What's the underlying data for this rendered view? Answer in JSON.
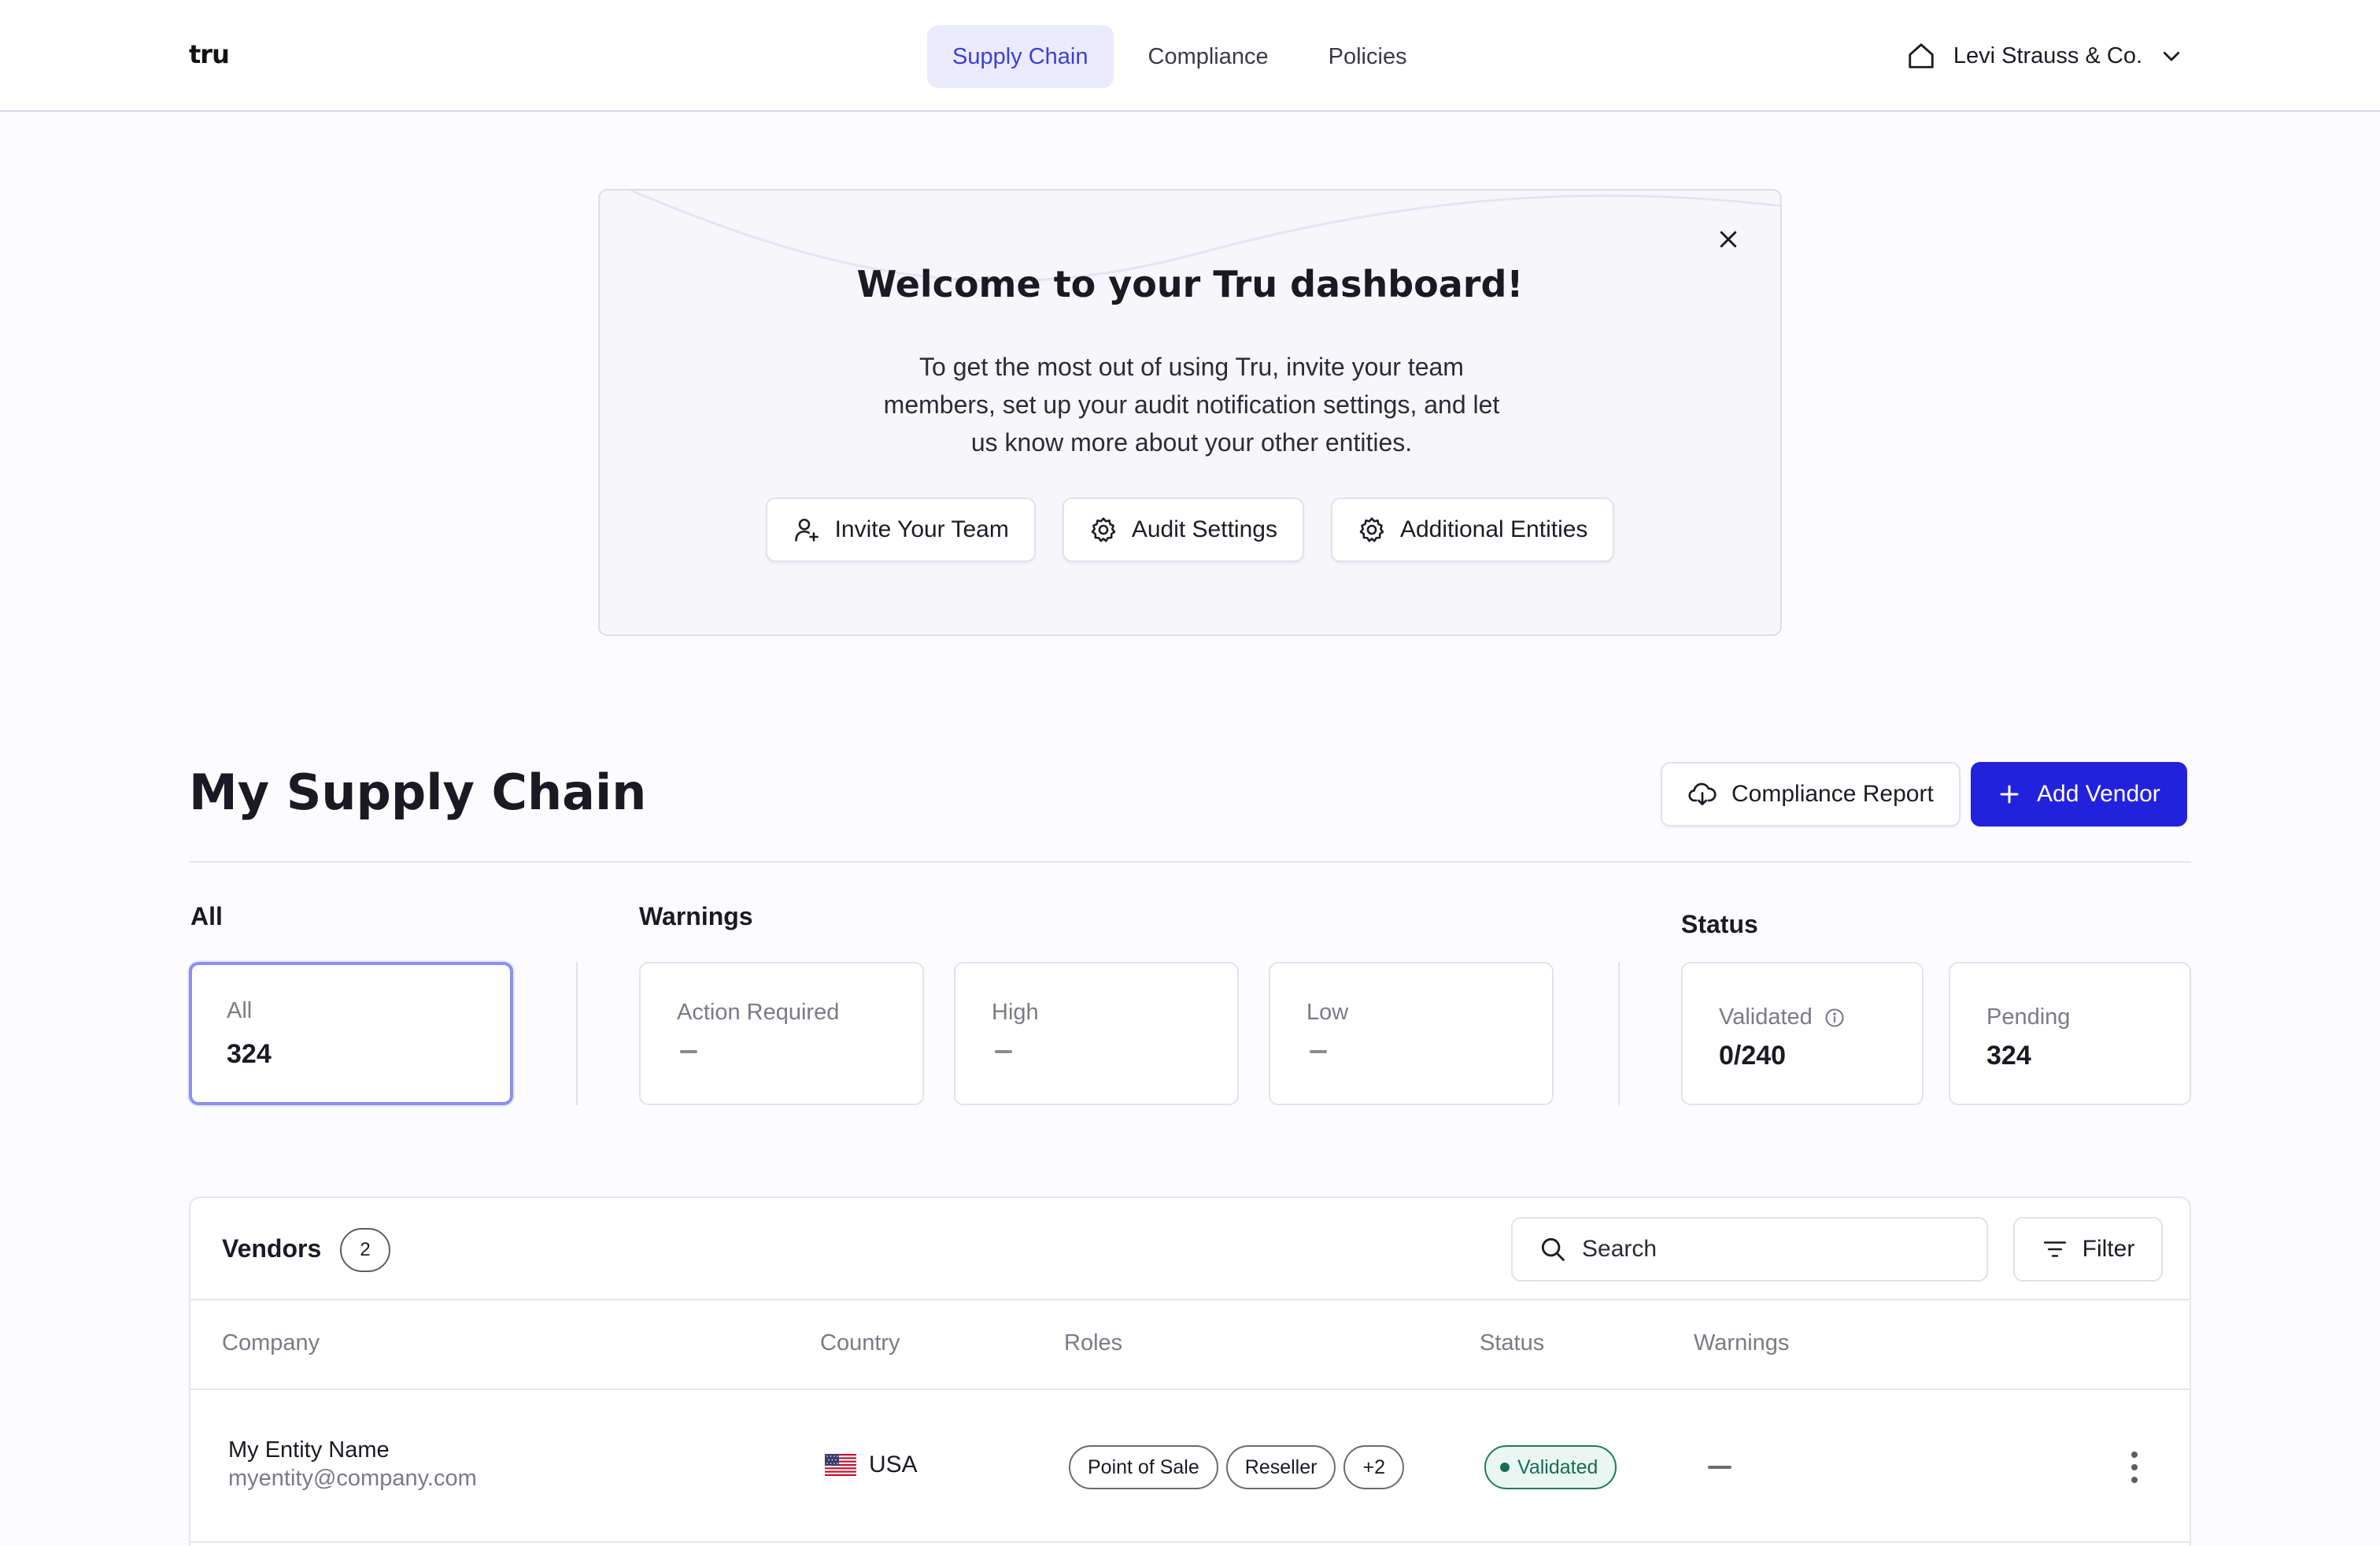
{
  "app": {
    "logo": "tru"
  },
  "nav": {
    "tabs": [
      {
        "label": "Supply Chain",
        "active": true
      },
      {
        "label": "Compliance",
        "active": false
      },
      {
        "label": "Policies",
        "active": false
      }
    ],
    "org_name": "Levi Strauss & Co.",
    "org_icon": "home-icon",
    "accent_color": "#3b3fd8"
  },
  "welcome": {
    "title": "Welcome to your Tru dashboard!",
    "body_lines": [
      "To get the most out of using Tru, invite your team",
      "members, set up your audit notification settings, and let",
      "us know more about your other entities."
    ],
    "actions": [
      {
        "label": "Invite Your Team",
        "icon": "user-plus-icon"
      },
      {
        "label": "Audit Settings",
        "icon": "gear-icon"
      },
      {
        "label": "Additional Entities",
        "icon": "gear-icon"
      }
    ]
  },
  "section": {
    "title": "My Supply Chain",
    "report_button": "Compliance Report",
    "add_button": "Add Vendor",
    "primary_color": "#2222dd"
  },
  "stats": {
    "all": {
      "group_label": "All",
      "card_label": "All",
      "value": "324"
    },
    "warnings": {
      "group_label": "Warnings",
      "cards": [
        {
          "label": "Action Required"
        },
        {
          "label": "High"
        },
        {
          "label": "Low"
        }
      ]
    },
    "status": {
      "group_label": "Status",
      "validated": {
        "label": "Validated",
        "value": "0/240"
      },
      "pending": {
        "label": "Pending",
        "value": "324"
      }
    }
  },
  "vendors": {
    "title": "Vendors",
    "count": "2",
    "search_placeholder": "Search",
    "filter_label": "Filter",
    "columns": [
      "Company",
      "Country",
      "Roles",
      "Status",
      "Warnings"
    ],
    "rows": [
      {
        "name": "My Entity Name",
        "email": "myentity@company.com",
        "country": "USA",
        "roles": [
          "Point of Sale",
          "Reseller",
          "+2"
        ],
        "status": "Validated",
        "status_color": "#1a6b55"
      }
    ]
  }
}
